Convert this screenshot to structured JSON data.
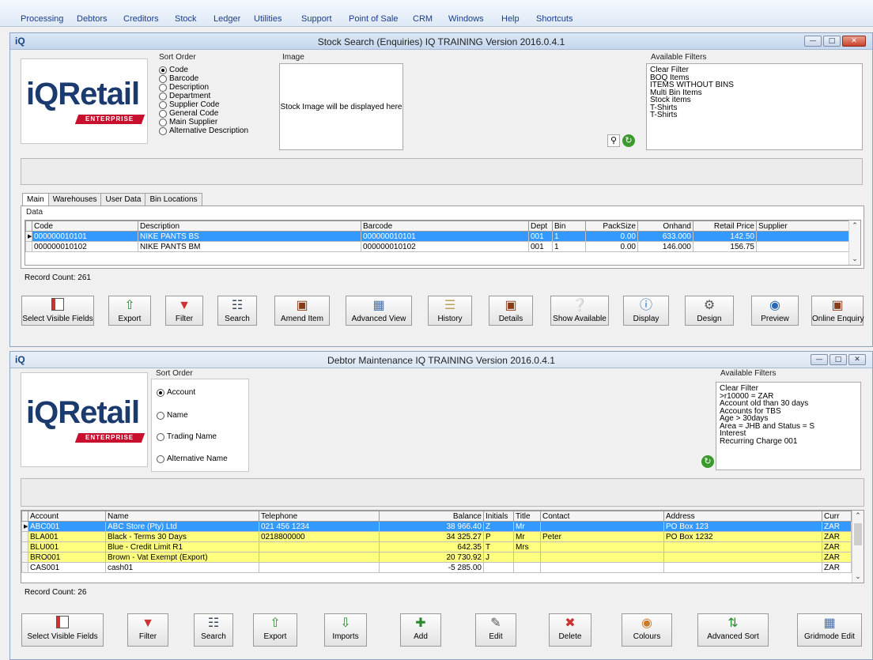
{
  "menu": [
    "Processing",
    "Debtors",
    "Creditors",
    "Stock",
    "Ledger",
    "Utilities",
    "Support",
    "Point of Sale",
    "CRM",
    "Windows",
    "Help",
    "Shortcuts"
  ],
  "stock": {
    "app_icon": "iQ",
    "title": "Stock Search (Enquiries) IQ TRAINING Version 2016.0.4.1",
    "logo": {
      "iq": "iQ",
      "retail": "Retail",
      "bar": "ENTERPRISE"
    },
    "sort_label": "Sort Order",
    "sort_options": [
      "Code",
      "Barcode",
      "Description",
      "Department",
      "Supplier Code",
      "General Code",
      "Main Supplier",
      "Alternative Description"
    ],
    "image_label": "Image",
    "image_text": "Stock Image will be displayed here",
    "filters_label": "Available Filters",
    "filters": [
      "Clear Filter",
      "BOQ Items",
      "ITEMS WITHOUT BINS",
      "Multi Bin Items",
      "Stock items",
      "T-Shirts",
      "T-Shirts"
    ],
    "tabs": [
      "Main",
      "Warehouses",
      "User Data",
      "Bin Locations"
    ],
    "data_label": "Data",
    "columns": [
      "Code",
      "Description",
      "Barcode",
      "Dept",
      "Bin",
      "PackSize",
      "Onhand",
      "Retail Price",
      "Supplier"
    ],
    "rows": [
      [
        "000000010101",
        "NIKE PANTS BS",
        "000000010101",
        "001",
        "1",
        "0.00",
        "633.000",
        "142.50",
        ""
      ],
      [
        "000000010102",
        "NIKE PANTS BM",
        "000000010102",
        "001",
        "1",
        "0.00",
        "146.000",
        "156.75",
        ""
      ]
    ],
    "record_count": "Record Count: 261",
    "toolbar": [
      "Select Visible Fields",
      "Export",
      "Filter",
      "Search",
      "Amend Item",
      "Advanced View",
      "History",
      "Details",
      "Show Available",
      "Display",
      "Design",
      "Preview",
      "Online Enquiry"
    ]
  },
  "debtor": {
    "app_icon": "iQ",
    "title": "Debtor Maintenance IQ TRAINING Version 2016.0.4.1",
    "logo": {
      "iq": "iQ",
      "retail": "Retail",
      "bar": "ENTERPRISE"
    },
    "sort_label": "Sort Order",
    "sort_options": [
      "Account",
      "Name",
      "Trading Name",
      "Alternative Name"
    ],
    "filters_label": "Available Filters",
    "filters": [
      "Clear Filter",
      ">r10000 = ZAR",
      "Account old than 30 days",
      "Accounts for TBS",
      "Age > 30days",
      "Area = JHB and Status = S",
      "Interest",
      "Recurring Charge 001"
    ],
    "columns": [
      "Account",
      "Name",
      "Telephone",
      "Balance",
      "Initials",
      "Title",
      "Contact",
      "Address",
      "Curr"
    ],
    "rows": [
      [
        "ABC001",
        "ABC Store (Pty) Ltd",
        "021 456 1234",
        "38 966.40",
        "Z",
        "Mr",
        "",
        "PO Box 123",
        "ZAR"
      ],
      [
        "BLA001",
        "Black - Terms 30 Days",
        "0218800000",
        "34 325.27",
        "P",
        "Mr",
        "Peter",
        "PO Box 1232",
        "ZAR"
      ],
      [
        "BLU001",
        "Blue - Credit Limit R1",
        "",
        "642.35",
        "T",
        "Mrs",
        "",
        "",
        "ZAR"
      ],
      [
        "BRO001",
        "Brown - Vat Exempt (Export)",
        "",
        "20 730.92",
        "J",
        "",
        "",
        "",
        "ZAR"
      ],
      [
        "CAS001",
        "cash01",
        "",
        "-5 285.00",
        "",
        "",
        "",
        "",
        "ZAR"
      ]
    ],
    "record_count": "Record Count: 26",
    "toolbar": [
      "Select Visible Fields",
      "Filter",
      "Search",
      "Export",
      "Imports",
      "Add",
      "Edit",
      "Delete",
      "Colours",
      "Advanced Sort",
      "Gridmode Edit"
    ]
  }
}
